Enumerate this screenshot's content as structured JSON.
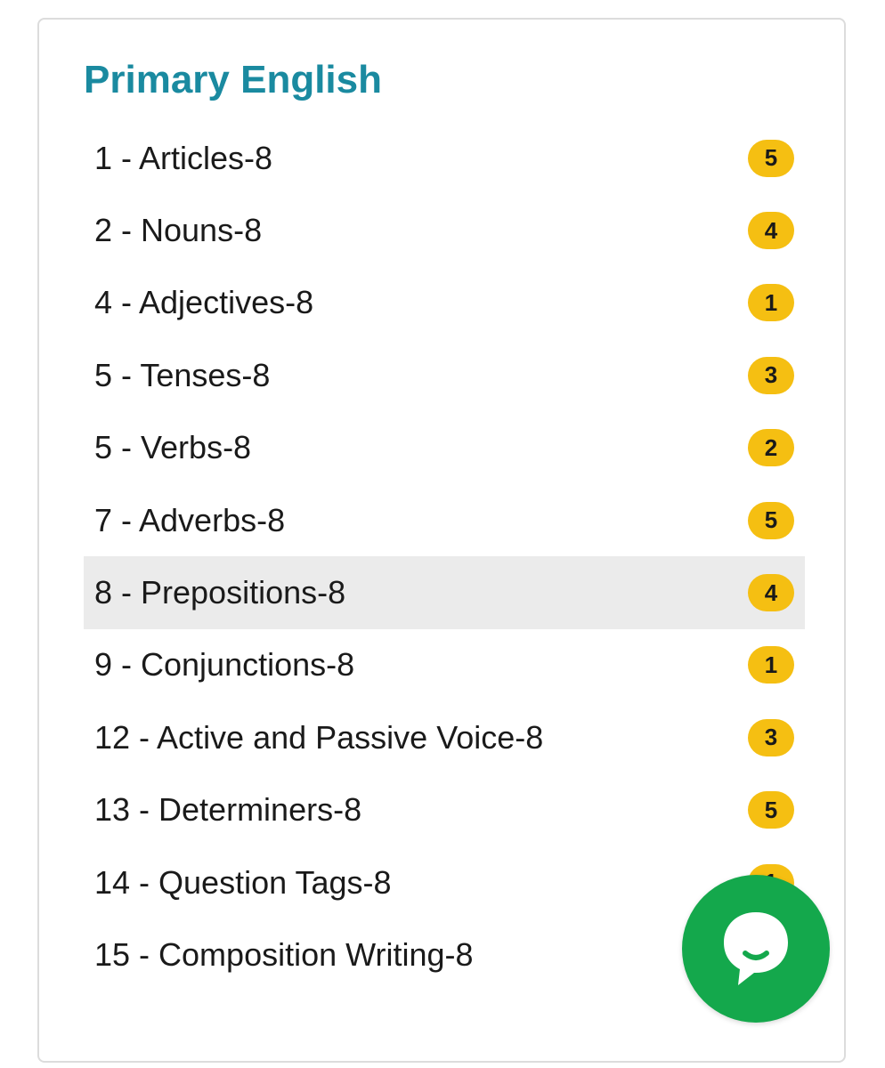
{
  "card": {
    "title": "Primary English"
  },
  "topics": [
    {
      "label": "1 - Articles-8",
      "count": "5"
    },
    {
      "label": "2 - Nouns-8",
      "count": "4"
    },
    {
      "label": "4 - Adjectives-8",
      "count": "1"
    },
    {
      "label": "5 - Tenses-8",
      "count": "3"
    },
    {
      "label": "5 - Verbs-8",
      "count": "2"
    },
    {
      "label": "7 - Adverbs-8",
      "count": "5"
    },
    {
      "label": "8 - Prepositions-8",
      "count": "4"
    },
    {
      "label": "9 - Conjunctions-8",
      "count": "1"
    },
    {
      "label": "12 - Active and Passive Voice-8",
      "count": "3"
    },
    {
      "label": "13 - Determiners-8",
      "count": "5"
    },
    {
      "label": "14 - Question Tags-8",
      "count": "1"
    },
    {
      "label": "15 - Composition Writing-8",
      "count": ""
    }
  ],
  "chat": {
    "icon": "chat-bubble-smile-icon"
  },
  "colors": {
    "title": "#1a8aa0",
    "badge": "#f5bf12",
    "chat_button": "#14a84c",
    "row_highlight": "#ebebeb"
  }
}
